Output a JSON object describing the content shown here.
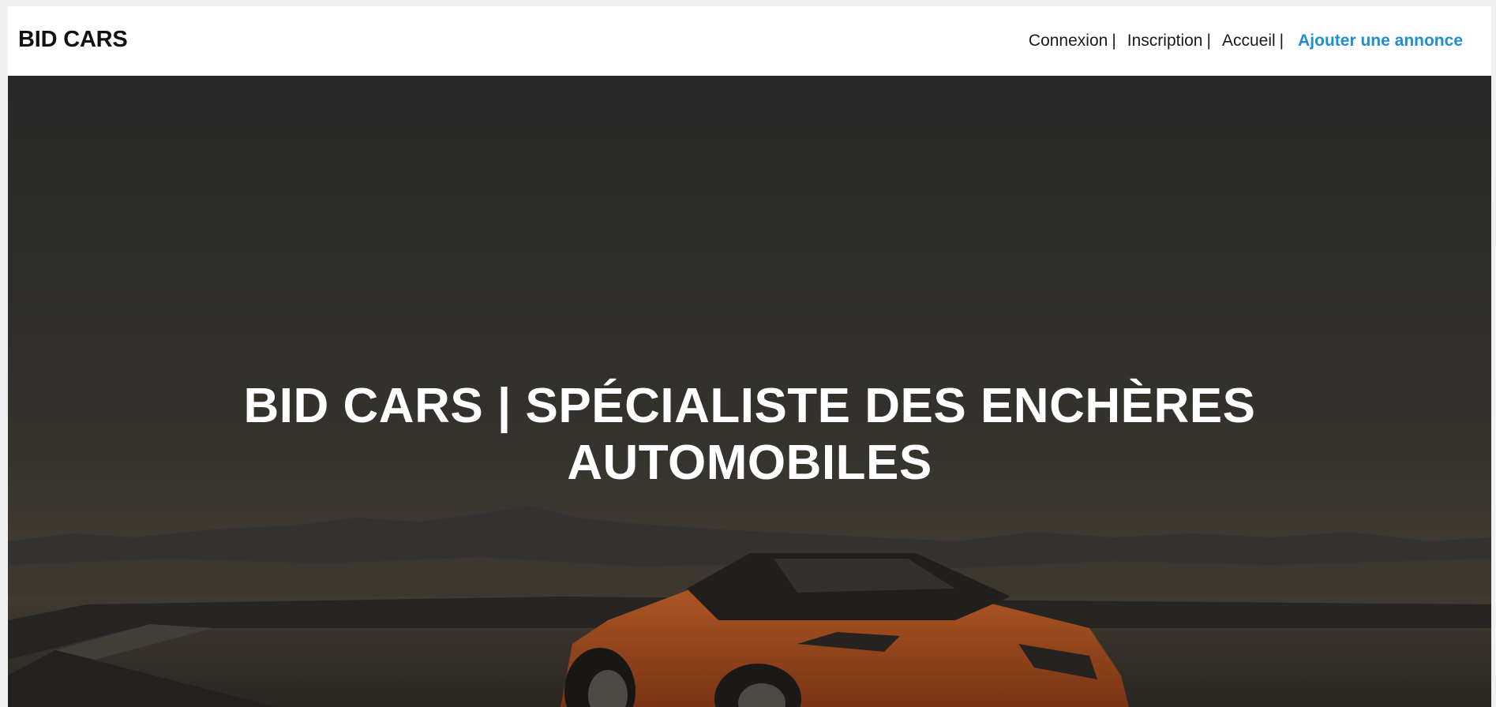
{
  "header": {
    "brand": "BID CARS",
    "nav": {
      "login": "Connexion",
      "signup": "Inscription",
      "home": "Accueil",
      "separator": "|",
      "add_listing": "Ajouter une annonce"
    }
  },
  "hero": {
    "title_line1": "BID CARS | SPÉCIALISTE DES ENCHÈRES",
    "title_line2": "AUTOMOBILES",
    "background_image": "orange-sports-car-desert-road"
  },
  "colors": {
    "accent": "#1e8fd0",
    "text_dark": "#111111",
    "hero_text": "#ffffff",
    "car_orange": "#c95a1e"
  }
}
